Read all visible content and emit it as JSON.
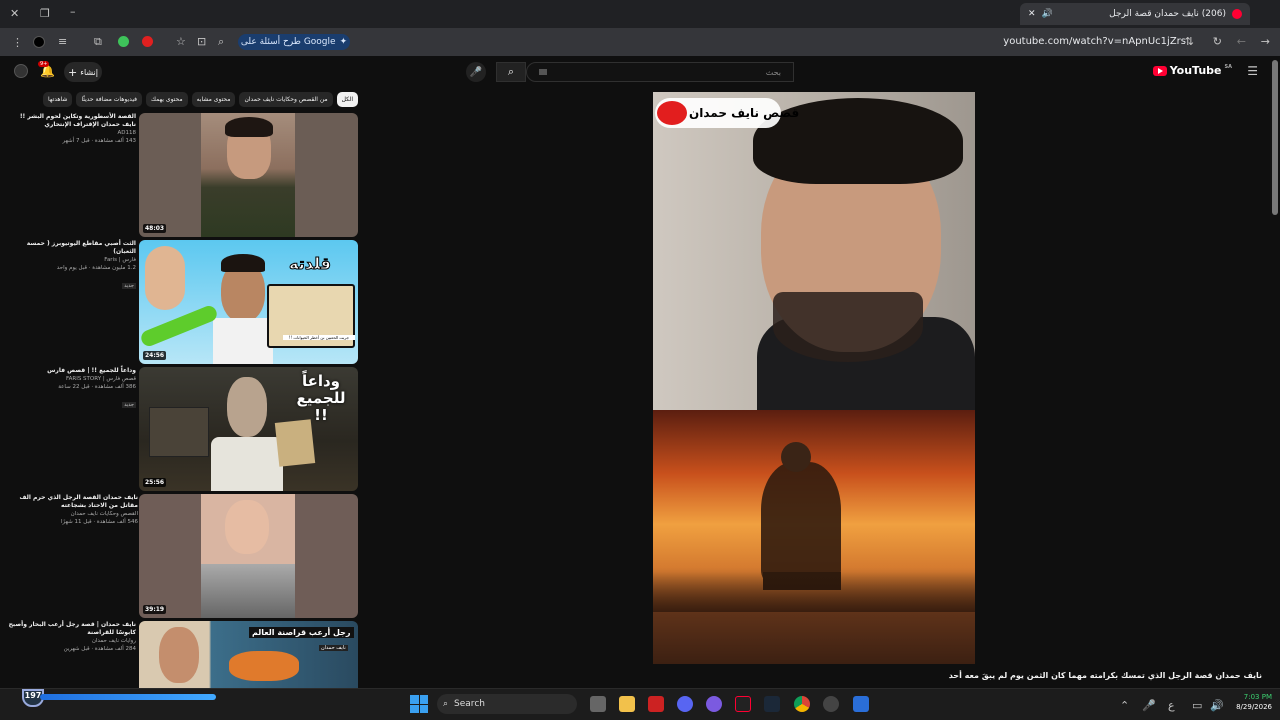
{
  "browser": {
    "tab_title": "(206) نايف حمدان قصة الرجل",
    "new_tab": "+",
    "ask_button": "طرح أسئلة على Google",
    "url": "youtube.com/watch?v=nApnUc1jZrs"
  },
  "youtube": {
    "logo": "YouTube",
    "logo_country": "SA",
    "search_placeholder": "بحث",
    "create_label": "إنشاء",
    "notification_count": "9+",
    "chips": [
      "الكل",
      "من القصص وحكايات نايف حمدان",
      "محتوى مشابه",
      "محتوى يهمك",
      "فيديوهات مضافة حديثًا",
      "شاهدتها"
    ],
    "related": [
      {
        "title": "القصة الأسطورية وتكاين لحوم البشر !! نايف حمدان الإقتراف الإنتحاري",
        "channel": "AD118",
        "stats": "143 ألف مشاهدة · قبل 7 أشهر",
        "duration": "48:03",
        "badge": ""
      },
      {
        "title": "الثت أصبي مقاطع اليوتيوبرز ( حمسة الثعبان)",
        "channel": "فارس | Faris",
        "stats": "1.2 مليون مشاهدة · قبل يوم واحد",
        "duration": "24:56",
        "badge": "جديد"
      },
      {
        "title": "وداعاً للجميع !! | قصص فارس",
        "channel": "قصص فارس | FARIS STORY",
        "stats": "386 ألف مشاهدة · قبل 22 ساعة",
        "duration": "25:56",
        "badge": "جديد"
      },
      {
        "title": "نايف حمدان القصة الرجل الذي حرم الف مقاتل من الاحتاد بشجاعته",
        "channel": "القصص وحكايات نايف حمدان",
        "stats": "546 ألف مشاهدة · قبل 11 شهرًا",
        "duration": "39:19",
        "badge": ""
      },
      {
        "title": "نايف حمدان | قصة رجل أرعب البحار وأصبح كابوسًا للقراصنة",
        "channel": "روايات نايف حمدان",
        "stats": "284 ألف مشاهدة · قبل شهرين",
        "duration": "",
        "badge": ""
      }
    ],
    "thumb_texts": {
      "t2_big": "قلدته",
      "t2_small": "جربت الحعبين بن أخطر الحيوانات !!",
      "t3_big": "وداعاً للجميع !!",
      "t5_big": "رجل أرعب قراصنة العالم",
      "t5_small": "نايف حمدان"
    },
    "player": {
      "watermark": "قصص نايف حمدان",
      "video_title": "نايف حمدان قصة الرجل الذي تمسك بكرامته مهما كان الثمن يوم لم يبقَ معه أحد"
    }
  },
  "taskbar": {
    "search_label": "Search",
    "badge_number": "197",
    "time": "7:03 PM",
    "date": "8/29/2026",
    "lang": "ع"
  }
}
